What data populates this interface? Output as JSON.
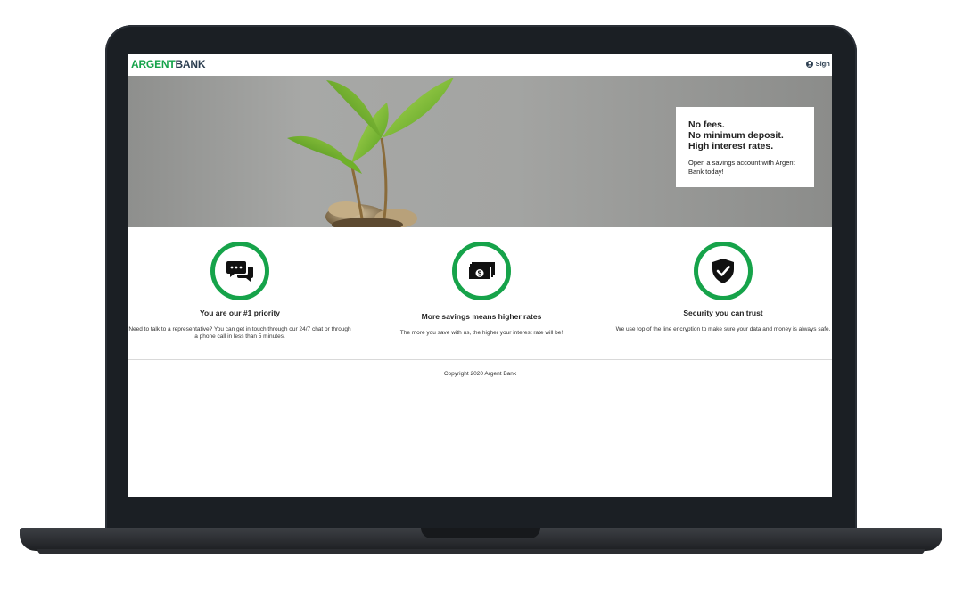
{
  "nav": {
    "logo_part1": "ARGENT",
    "logo_part2": "BANK",
    "signin_label": "Sign I",
    "signin_icon": "user-circle-icon"
  },
  "hero": {
    "subtitle_1": "No fees.",
    "subtitle_2": "No minimum deposit.",
    "subtitle_3": "High interest rates.",
    "text": "Open a savings account with Argent Bank today!"
  },
  "features": [
    {
      "icon": "chat-bubbles-icon",
      "title": "You are our #1 priority",
      "text": "Need to talk to a representative? You can get in touch through our 24/7 chat or through a phone call in less than 5 minutes."
    },
    {
      "icon": "money-bill-icon",
      "title": "More savings means higher rates",
      "text": "The more you save with us, the higher your interest rate will be!"
    },
    {
      "icon": "shield-check-icon",
      "title": "Security you can trust",
      "text": "We use top of the line encryption to make sure your data and money is always safe."
    }
  ],
  "footer": {
    "copyright": "Copyright 2020 Argent Bank"
  },
  "colors": {
    "accent": "#16a34a",
    "text_dark": "#2c3e50",
    "frame": "#1b1f24"
  }
}
